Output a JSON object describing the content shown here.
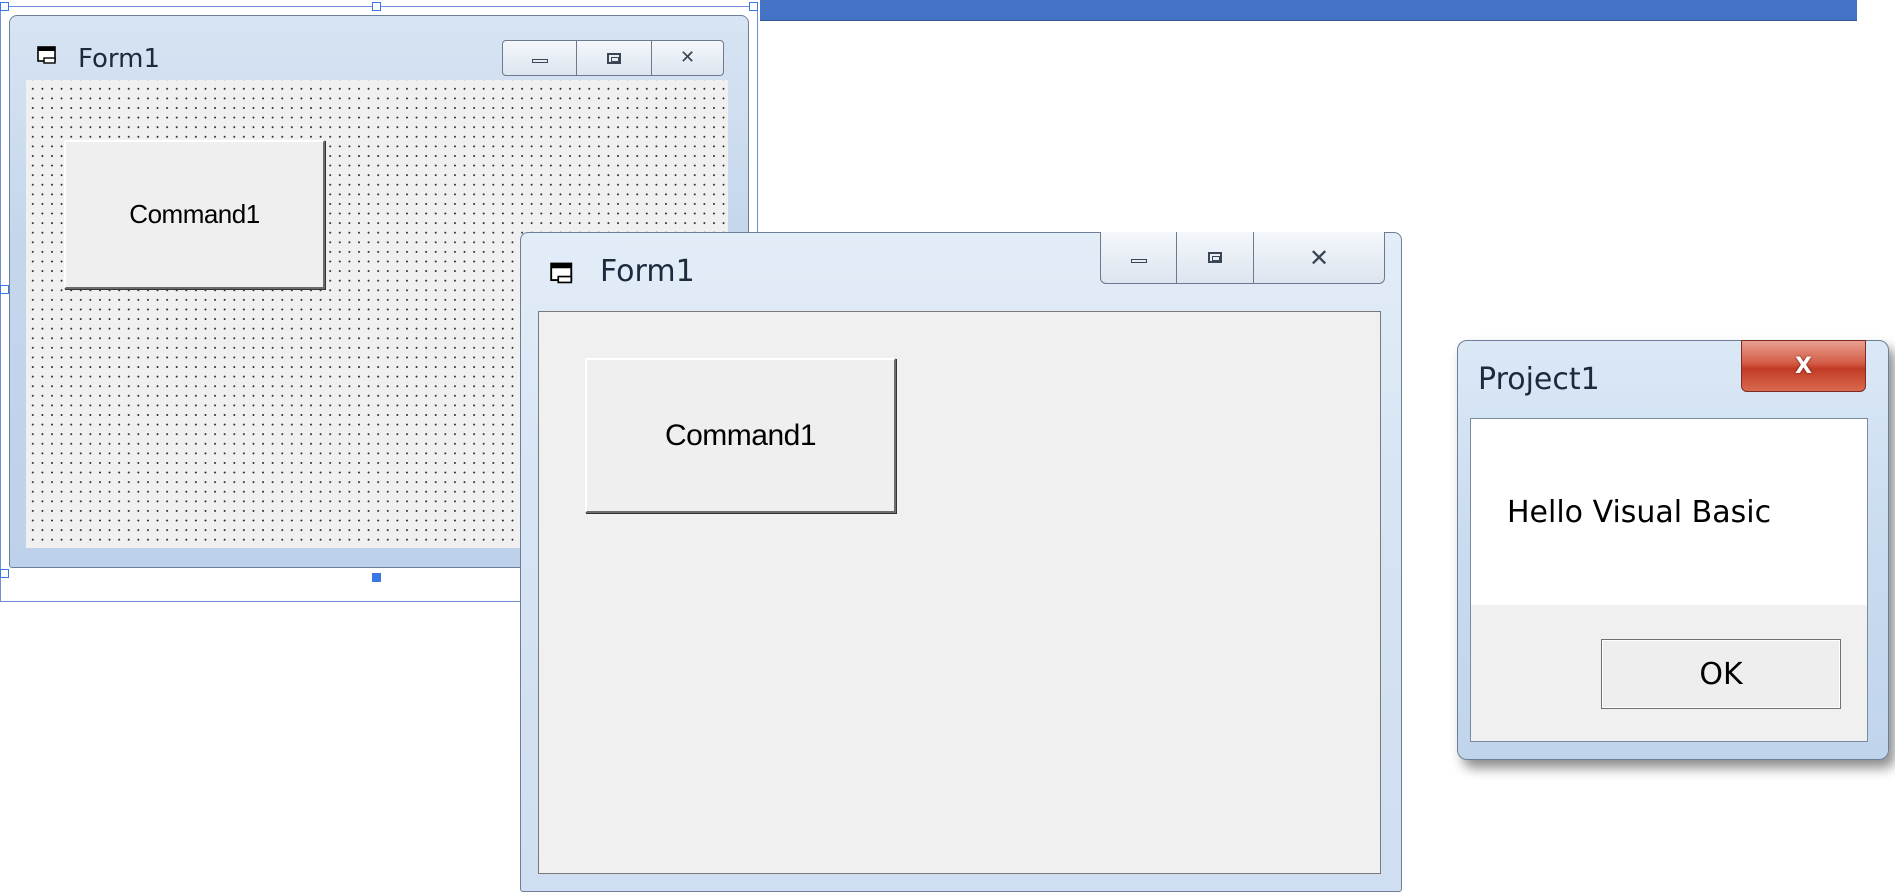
{
  "design_form": {
    "title": "Form1",
    "button_label": "Command1",
    "icon": "form-icon"
  },
  "runtime_form": {
    "title": "Form1",
    "button_label": "Command1",
    "icon": "form-icon"
  },
  "message_box": {
    "title": "Project1",
    "message": "Hello Visual Basic",
    "ok_label": "OK",
    "close_glyph": "X"
  },
  "colors": {
    "accent_bar": "#4472c4",
    "selection": "#3b78e7",
    "close_button": "#c9432e",
    "form_background": "#f0f0f0"
  }
}
